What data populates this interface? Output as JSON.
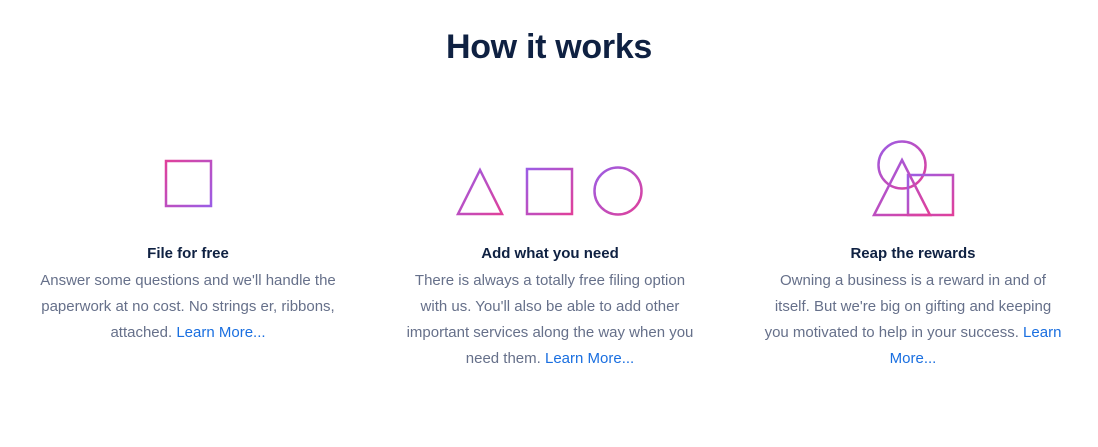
{
  "section": {
    "title": "How it works"
  },
  "features": [
    {
      "title": "File for free",
      "body": "Answer some questions and we'll handle the paperwork at no cost. No strings er, ribbons, attached.",
      "link": "Learn More...",
      "icon": "square-icon"
    },
    {
      "title": "Add what you need",
      "body": "There is always a totally free filing option with us. You'll also be able to add other important services along the way when you need them.",
      "link": "Learn More...",
      "icon": "triangle-square-circle-icon"
    },
    {
      "title": "Reap the rewards",
      "body": "Owning a business is a reward in and of itself. But we're big on gifting and keeping you motivated to help in your success.",
      "link": "Learn More...",
      "icon": "stacked-shapes-icon"
    }
  ],
  "colors": {
    "heading": "#0f2142",
    "body_text": "#66708a",
    "link": "#1a6fe0",
    "gradient_start": "#9b5de5",
    "gradient_end": "#e0409a"
  }
}
